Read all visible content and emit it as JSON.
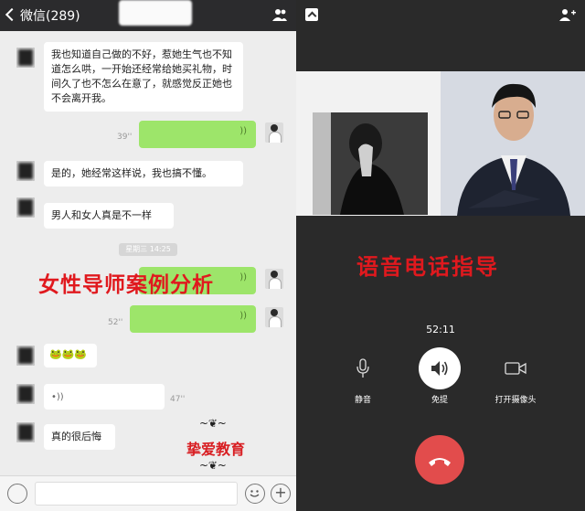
{
  "chat": {
    "header": {
      "back_label": "微信(289)"
    },
    "messages": [
      {
        "text": "我也知道自己做的不好，惹她生气也不知道怎么哄，一开始还经常给她买礼物，时间久了也不怎么在意了，就感觉反正她也不会离开我。"
      },
      {
        "duration": "39''"
      },
      {
        "text": "是的，她经常这样说，我也搞不懂。"
      },
      {
        "text": "男人和女人真是不一样"
      },
      {
        "timestamp": "星期三 14:25"
      },
      {
        "duration": "52''"
      },
      {
        "emoji": "🐸🐸🐸"
      },
      {
        "duration": "47''"
      },
      {
        "text": "真的很后悔"
      }
    ],
    "overlay_title": "女性导师案例分析",
    "brand": "挚爱教育"
  },
  "call": {
    "overlay_title": "语音电话指导",
    "timer": "52:11",
    "controls": [
      {
        "label": "静音",
        "icon": "microphone-icon"
      },
      {
        "label": "免提",
        "icon": "speaker-icon"
      },
      {
        "label": "打开摄像头",
        "icon": "camera-icon"
      }
    ],
    "hangup_icon": "hang-up-icon"
  },
  "colors": {
    "bubble_green": "#9de56a",
    "overlay_red": "#e0191e",
    "hangup_red": "#e24c4c",
    "call_bg": "#2a2a2a"
  }
}
